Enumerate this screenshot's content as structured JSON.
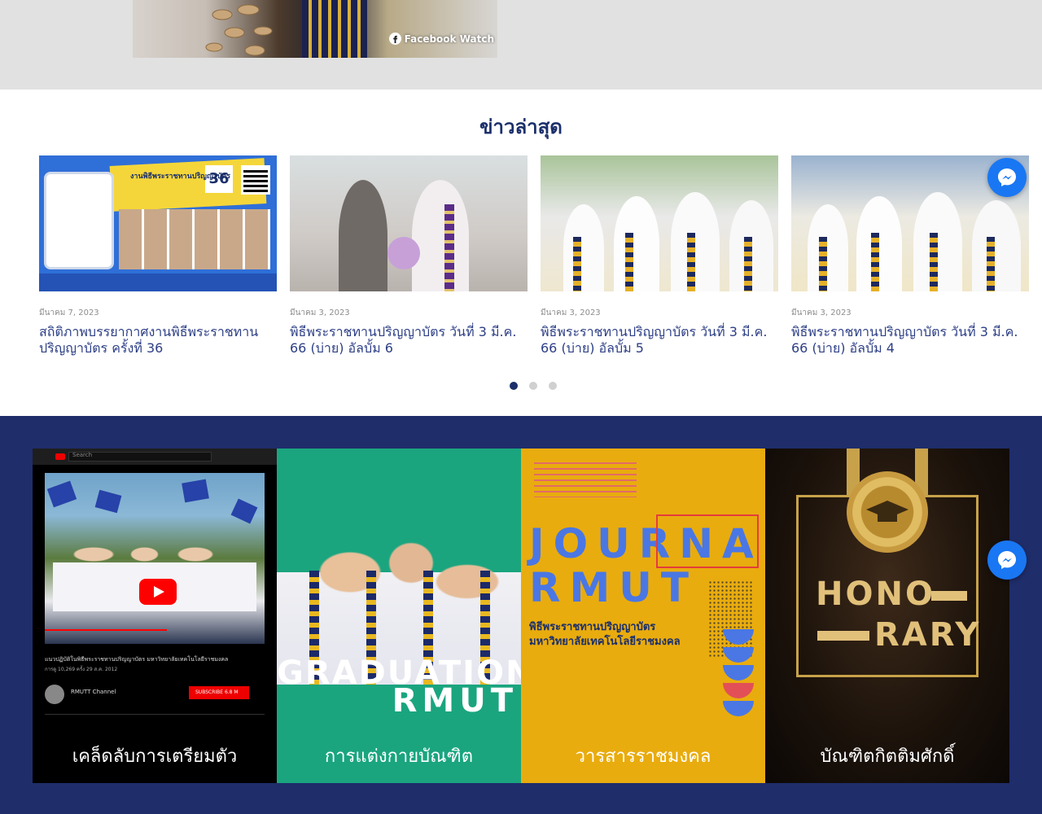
{
  "video": {
    "badge_label": "Facebook Watch"
  },
  "news": {
    "title": "ข่าวล่าสุด",
    "items": [
      {
        "date": "มีนาคม 7, 2023",
        "headline": "สถิติภาพบรรยากาศงานพิธีพระราชทานปริญญาบัตร ครั้งที่ 36",
        "image_text": "งานพิธีพระราชทานปริญญาบัตร",
        "image_number": "36"
      },
      {
        "date": "มีนาคม 3, 2023",
        "headline": "พิธีพระราชทานปริญญาบัตร วันที่ 3 มี.ค. 66 (บ่าย) อัลบั้ม 6"
      },
      {
        "date": "มีนาคม 3, 2023",
        "headline": "พิธีพระราชทานปริญญาบัตร วันที่ 3 มี.ค. 66 (บ่าย) อัลบั้ม 5"
      },
      {
        "date": "มีนาคม 3, 2023",
        "headline": "พิธีพระราชทานปริญญาบัตร วันที่ 3 มี.ค. 66 (บ่าย) อัลบั้ม 4"
      }
    ],
    "pagination": {
      "total": 3,
      "active": 1
    }
  },
  "tiles": [
    {
      "caption": "เคล็ดลับการเตรียมตัว",
      "youtube": {
        "search_placeholder": "Search",
        "video_title": "แนวปฏิบัติในพิธีพระราชทานปริญญาบัตร มหาวิทยาลัยเทคโนโลยีราชมงคล",
        "meta": "การดู 10,269 ครั้ง  29 ส.ค. 2012",
        "channel": "RMUTT Channel",
        "subscribe": "SUBSCRIBE  6.8 M"
      }
    },
    {
      "caption": "การแต่งกายบัณฑิต",
      "word1": "GRADUATION",
      "word2": "RMUT"
    },
    {
      "caption": "วารสารราชมงคล",
      "word1": "JOURNAL",
      "word2": "RMUT",
      "thai1": "พิธีพระราชทานปริญญาบัตร",
      "thai2": "มหาวิทยาลัยเทคโนโลยีราชมงคล"
    },
    {
      "caption": "บัณฑิตกิตติมศักดิ์",
      "word1": "HONO",
      "word2": "RARY"
    }
  ],
  "colors": {
    "navy": "#1f2d6b",
    "title_navy": "#1b2f6b",
    "link_blue": "#2d3f86",
    "messenger": "#1977f3"
  }
}
